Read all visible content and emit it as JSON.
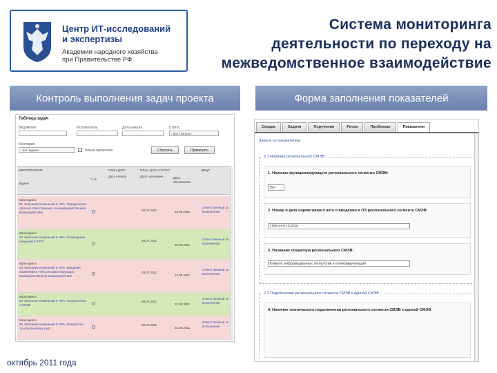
{
  "header": {
    "logo_title": [
      "Центр ИТ-исследований",
      "и экспертизы"
    ],
    "logo_sub": [
      "Академии народного хозяйства",
      "при Правительстве РФ"
    ],
    "title": [
      "Система мониторинга",
      "деятельности по переходу на",
      "межведомственное взаимодействие"
    ]
  },
  "left_section": {
    "heading": "Контроль выполнения задач проекта",
    "table_title": "Таблица задач",
    "filters": {
      "field1": "Ведомство",
      "field2": "Исполнитель",
      "field3": "Дата начала",
      "field4": "Статус",
      "select_all": "- все статусы -",
      "label_bottom": "Категория",
      "select_bottom": "- все задачи -",
      "checkbox": "Только просрочен.",
      "reset_btn": "Сбросить",
      "apply_btn": "Применить"
    },
    "grid_headers": {
      "col1": "МЕРОПРИЯТИЕ",
      "col1b": "Задача",
      "col3a": "ПЛАН ДАТА",
      "col3b": "Дата начала",
      "col4a": "ПЛАН ДАТА СТАТУС",
      "col4b": "Дата окончания",
      "col5": "Дата обновления",
      "col6": "ЛИЦО"
    },
    "rows": [
      {
        "color": "pink",
        "task": "Категория 1",
        "text": "01. Внесение изменений в НПА. Определение органов ответственных за межведомственное взаимодействие",
        "date1": "29.07.2011",
        "date2": "22.09.2011",
        "link": "Ответственный за выполнение"
      },
      {
        "color": "green",
        "task": "Категория 2",
        "text": "02. Внесение изменений в НПА. Размещение сведений в РРГУ",
        "date1": "29.07.2011",
        "date2": "30.09.2011",
        "link": "Ответственный за выполнение"
      },
      {
        "color": "pink",
        "task": "Категория 3",
        "text": "03. Внесение изменений в НПА. Введение изменений в НПА регламентирующих межведомственное взаимодействие",
        "date1": "29.07.2011",
        "date2": "22.09.2011",
        "link": "Ответственный за выполнение"
      },
      {
        "color": "green",
        "task": "Категория 4",
        "text": "04. Внесение изменений в НПА. Подключение к СМЭВ",
        "date1": "29.07.2011",
        "date2": "22.09.2011",
        "link": "Ответственный за выполнение"
      },
      {
        "color": "pink",
        "task": "Категория 5",
        "text": "05. Внесение изменений в НПА. Разработка технологических карт",
        "date1": "29.07.2011",
        "date2": "22.09.2011",
        "link": "Ответственный за выполнение"
      }
    ]
  },
  "right_section": {
    "heading": "Форма заполнения показателей",
    "tabs": [
      "Сводка",
      "Задачи",
      "Поручения",
      "Риски",
      "Проблемы",
      "Показатели"
    ],
    "active_tab": 5,
    "top_link": "Записи по показателям",
    "group1_legend": "2.1 Наличие регионального СМЭВ",
    "q1_label": "1. Наличие функционирующего регионального сегмента СМЭВ:",
    "q1_value": "Нет",
    "q2_label": "3. Номер и дата нормативного акта о введении в ПЭ регионального сегмента СМЭВ:",
    "q2_value": "1999 от 8.10.2010",
    "q3_label": "3. Название оператора регионального СМЭВ:",
    "q3_value": "Комитет информационных технологий и телекоммуникаций",
    "group2_legend": "2.2 Подключение регионального сегмента СМЭВ к единой СМЭВ",
    "q4_label": "4. Наличие технического подключения регионального сегмента СМЭВ к единой СМЭВ"
  },
  "footer": {
    "date": "октябрь 2011 года"
  },
  "colors": {
    "accent": "#1a2e5c",
    "bar": "#7d91ba",
    "row_pink": "#f7d8d8",
    "row_green": "#d7e8b8"
  }
}
